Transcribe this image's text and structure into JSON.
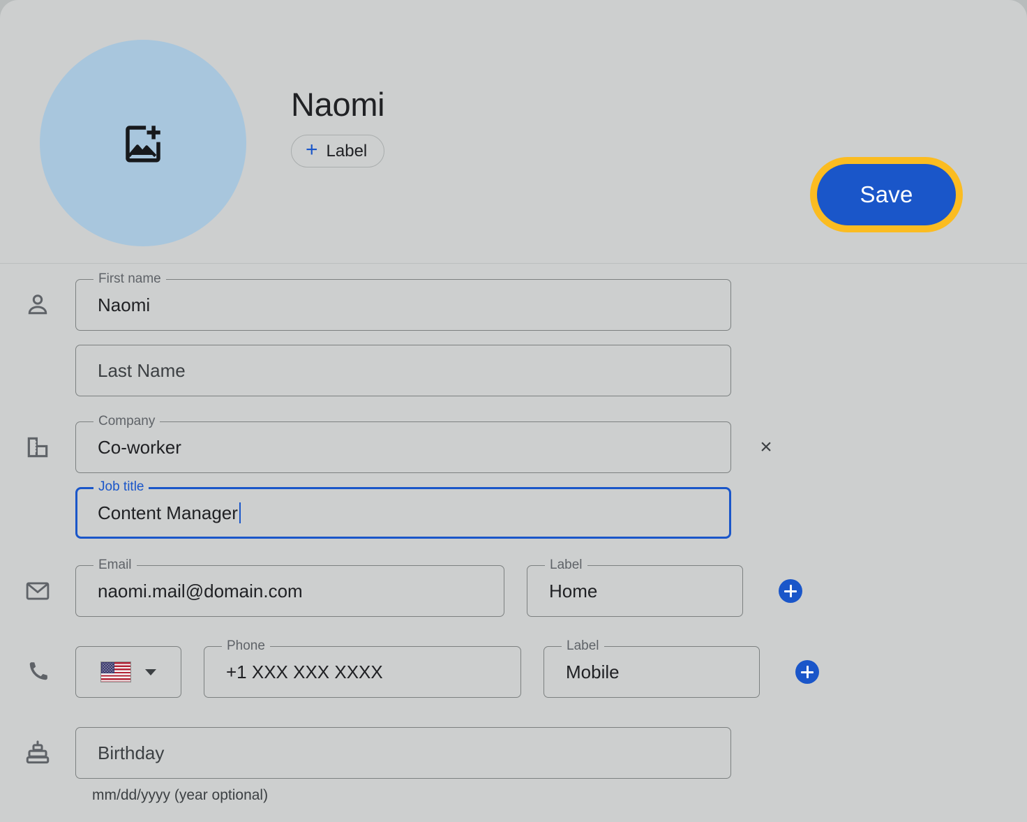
{
  "colors": {
    "page_background": "#cdcfcf",
    "avatar_background": "#a8c6dd",
    "accent_blue": "#1a56c9",
    "focus_ring_amber": "#fbbc21",
    "field_border": "#7c8080",
    "label_text": "#5f6368",
    "value_text": "#202124"
  },
  "header": {
    "avatar": {
      "icon": "add-photo-icon"
    },
    "contact_name": "Naomi",
    "add_label_button": {
      "icon": "plus-icon",
      "label": "Label"
    },
    "save_button": {
      "label": "Save",
      "focused": true
    }
  },
  "form": {
    "rows": [
      {
        "icon": "person-icon",
        "fields": [
          {
            "name": "first-name",
            "floating_label": "First name",
            "value": "Naomi",
            "focused": false
          },
          {
            "name": "last-name",
            "floating_label": "",
            "value": "Last Name",
            "is_placeholder": true,
            "focused": false
          }
        ]
      },
      {
        "icon": "building-icon",
        "fields": [
          {
            "name": "company",
            "floating_label": "Company",
            "value": "Co-worker",
            "focused": false
          },
          {
            "name": "job-title",
            "floating_label": "Job title",
            "value": "Content Manager",
            "focused": true
          }
        ],
        "trailing": {
          "icon": "close-icon",
          "label": "×"
        }
      },
      {
        "icon": "mail-icon",
        "fields": [
          {
            "name": "email",
            "floating_label": "Email",
            "value": "naomi.mail@domain.com",
            "focused": false
          },
          {
            "name": "email-label",
            "floating_label": "Label",
            "value": "Home",
            "focused": false
          }
        ],
        "trailing": {
          "icon": "add-circle-icon"
        }
      },
      {
        "icon": "phone-icon",
        "country_select": {
          "flag": "us-flag-icon",
          "chevron": "chevron-down-icon"
        },
        "fields": [
          {
            "name": "phone",
            "floating_label": "Phone",
            "value": "+1 XXX XXX XXXX",
            "focused": false
          },
          {
            "name": "phone-label",
            "floating_label": "Label",
            "value": "Mobile",
            "focused": false
          }
        ],
        "trailing": {
          "icon": "add-circle-icon"
        }
      },
      {
        "icon": "cake-icon",
        "fields": [
          {
            "name": "birthday",
            "floating_label": "",
            "value": "Birthday",
            "is_placeholder": true,
            "focused": false
          }
        ],
        "helper_text": "mm/dd/yyyy (year optional)"
      }
    ]
  }
}
